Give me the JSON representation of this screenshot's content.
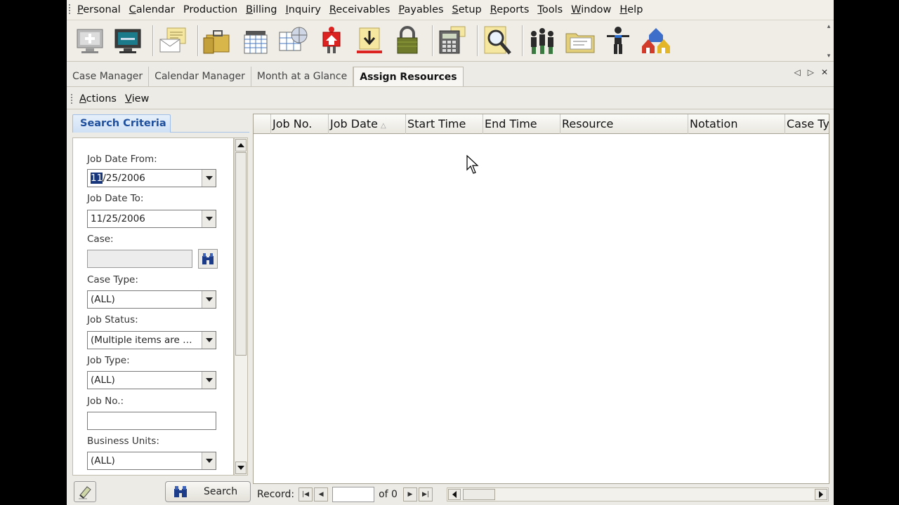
{
  "menu": {
    "items": [
      {
        "label": "Personal",
        "key": "P",
        "rest": "ersonal"
      },
      {
        "label": "Calendar",
        "key": "C",
        "rest": "alendar"
      },
      {
        "label": "Production",
        "key": "",
        "rest": "Production"
      },
      {
        "label": "Billing",
        "key": "B",
        "rest": "illing"
      },
      {
        "label": "Inquiry",
        "key": "I",
        "rest": "nquiry"
      },
      {
        "label": "Receivables",
        "key": "R",
        "rest": "eceivables"
      },
      {
        "label": "Payables",
        "key": "P",
        "rest": "ayables"
      },
      {
        "label": "Setup",
        "key": "S",
        "rest": "etup"
      },
      {
        "label": "Reports",
        "key": "R",
        "rest": "eports"
      },
      {
        "label": "Tools",
        "key": "T",
        "rest": "ools"
      },
      {
        "label": "Window",
        "key": "W",
        "rest": "indow"
      },
      {
        "label": "Help",
        "key": "H",
        "rest": "elp"
      }
    ]
  },
  "toolbar": {
    "icons": [
      "new-case-icon",
      "computer-icon",
      "mail-icon",
      "briefcase-icon",
      "calendar-icon",
      "calendar-globe-icon",
      "building-icon",
      "download-icon",
      "lock-icon",
      "calculator-icon",
      "magnify-document-icon",
      "people-icon",
      "folder-card-icon",
      "person-icon",
      "houses-icon"
    ]
  },
  "tabs": {
    "items": [
      {
        "label": "Case Manager",
        "active": false
      },
      {
        "label": "Calendar Manager",
        "active": false
      },
      {
        "label": "Month at a Glance",
        "active": false
      },
      {
        "label": "Assign Resources",
        "active": true
      }
    ]
  },
  "actions": {
    "actions_key": "A",
    "actions_rest": "ctions",
    "view_key": "V",
    "view_rest": "iew"
  },
  "search": {
    "header": "Search Criteria",
    "job_date_from_label": "Job Date From:",
    "job_date_from_hl": "11",
    "job_date_from_rest": "/25/2006",
    "job_date_to_label": "Job Date To:",
    "job_date_to_value": "11/25/2006",
    "case_label": "Case:",
    "case_value": "",
    "case_type_label": "Case Type:",
    "case_type_value": "(ALL)",
    "job_status_label": "Job Status:",
    "job_status_value": "(Multiple items are selected)",
    "job_type_label": "Job Type:",
    "job_type_value": "(ALL)",
    "job_no_label": "Job No.:",
    "job_no_value": "",
    "business_units_label": "Business Units:",
    "business_units_value": "(ALL)",
    "search_button": "Search"
  },
  "grid": {
    "columns": [
      "Job No.",
      "Job Date",
      "Start Time",
      "End Time",
      "Resource",
      "Notation",
      "Case Ty"
    ],
    "sort_indicator": "△",
    "rows": []
  },
  "navigator": {
    "record_label": "Record:",
    "current": "",
    "total_label": "of 0"
  },
  "colors": {
    "accent": "#1e4f9e",
    "selection": "#16357a"
  }
}
